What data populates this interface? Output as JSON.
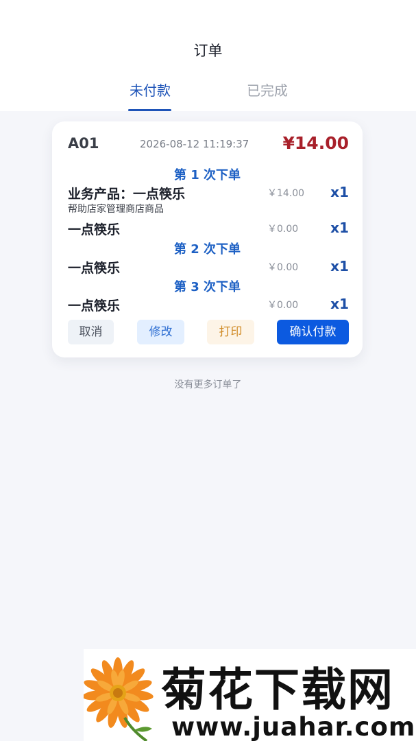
{
  "header": {
    "title": "订单",
    "tabs": [
      {
        "label": "未付款",
        "active": true
      },
      {
        "label": "已完成",
        "active": false
      }
    ]
  },
  "order": {
    "table": "A01",
    "time": "2026-08-12 11:19:37",
    "total": "¥14.00",
    "rounds": [
      {
        "title": "第 1 次下单",
        "items": [
          {
            "name": "业务产品：一点筷乐",
            "desc": "帮助店家管理商店商品",
            "price": "￥14.00",
            "qty": "x1"
          },
          {
            "name": "一点筷乐",
            "price": "￥0.00",
            "qty": "x1"
          }
        ]
      },
      {
        "title": "第 2 次下单",
        "items": [
          {
            "name": "一点筷乐",
            "price": "￥0.00",
            "qty": "x1"
          }
        ]
      },
      {
        "title": "第 3 次下单",
        "items": [
          {
            "name": "一点筷乐",
            "price": "￥0.00",
            "qty": "x1"
          }
        ]
      }
    ],
    "actions": {
      "cancel": "取消",
      "edit": "修改",
      "print": "打印",
      "pay": "确认付款"
    }
  },
  "footer_text": "没有更多订单了",
  "watermark": {
    "title": "菊花下载网",
    "url": "www.juahar.com"
  },
  "colors": {
    "accent": "#1e54b8",
    "price_red": "#a8202a",
    "pay_button": "#0c5ae0"
  }
}
